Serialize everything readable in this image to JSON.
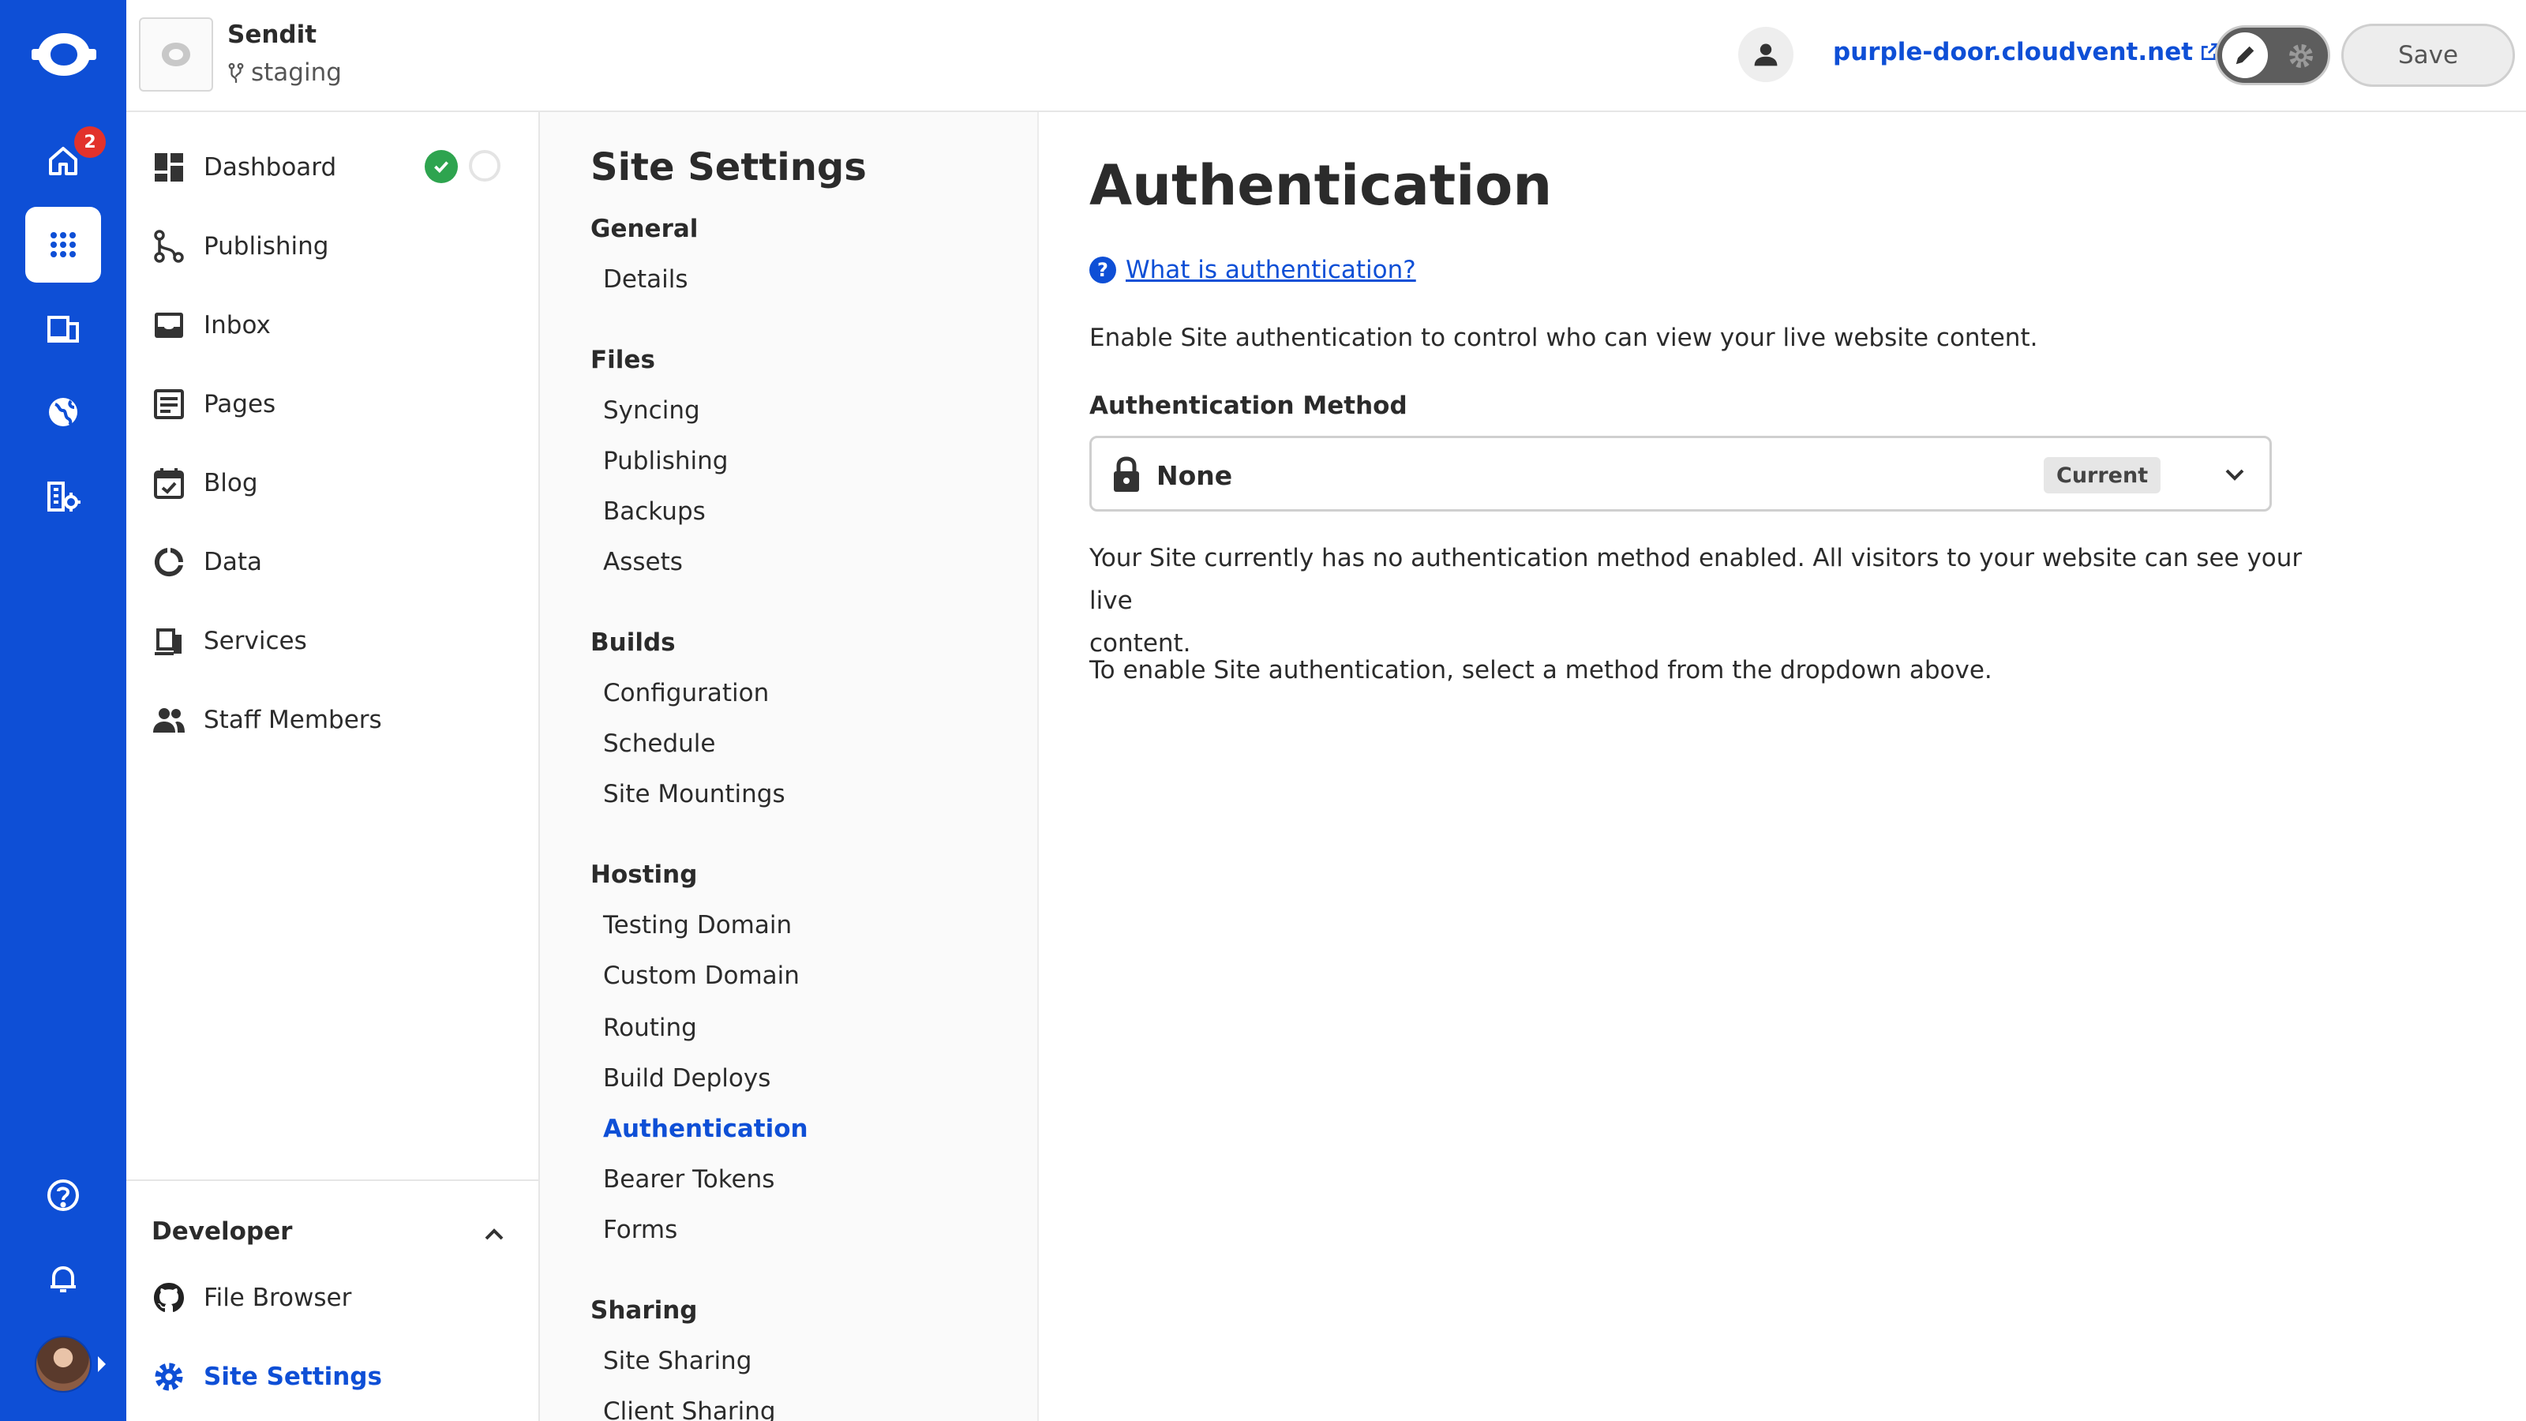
{
  "rail": {
    "home_badge": "2",
    "items": [
      "home-icon",
      "apps-grid-icon",
      "devices-icon",
      "globe-icon",
      "org-settings-icon",
      "help-icon",
      "bell-icon"
    ]
  },
  "topbar": {
    "site_name": "Sendit",
    "branch": "staging",
    "domain": "purple-door.cloudvent.net",
    "save_label": "Save"
  },
  "nav": {
    "items": [
      {
        "label": "Dashboard",
        "icon": "dashboard-icon"
      },
      {
        "label": "Publishing",
        "icon": "publishing-icon"
      },
      {
        "label": "Inbox",
        "icon": "inbox-icon"
      },
      {
        "label": "Pages",
        "icon": "pages-icon"
      },
      {
        "label": "Blog",
        "icon": "blog-icon"
      },
      {
        "label": "Data",
        "icon": "data-icon"
      },
      {
        "label": "Services",
        "icon": "services-icon"
      },
      {
        "label": "Staff Members",
        "icon": "staff-icon"
      }
    ],
    "developer": {
      "title": "Developer",
      "items": [
        {
          "label": "File Browser",
          "icon": "github-icon"
        },
        {
          "label": "Site Settings",
          "icon": "gear-icon",
          "active": true
        }
      ]
    }
  },
  "subnav": {
    "title": "Site Settings",
    "groups": [
      {
        "heading": "General",
        "links": [
          "Details"
        ]
      },
      {
        "heading": "Files",
        "links": [
          "Syncing",
          "Publishing",
          "Backups",
          "Assets"
        ]
      },
      {
        "heading": "Builds",
        "links": [
          "Configuration",
          "Schedule",
          "Site Mountings"
        ]
      },
      {
        "heading": "Hosting",
        "links": [
          "Testing Domain",
          "Custom Domain",
          "Routing",
          "Build Deploys",
          "Authentication",
          "Bearer Tokens",
          "Forms"
        ]
      },
      {
        "heading": "Sharing",
        "links": [
          "Site Sharing",
          "Client Sharing"
        ]
      }
    ],
    "active": "Authentication"
  },
  "content": {
    "title": "Authentication",
    "help_link": "What is authentication?",
    "intro": "Enable Site authentication to control who can view your live website content.",
    "method_label": "Authentication Method",
    "method_value": "None",
    "method_badge": "Current",
    "desc_line1": "Your Site currently has no authentication method enabled. All visitors to your website can see your live",
    "desc_line2": "content.",
    "instruction": "To enable Site authentication, select a method from the dropdown above."
  },
  "colors": {
    "brand_blue": "#0e4fd6",
    "badge_red": "#e2322b",
    "status_green": "#2ea44f"
  }
}
